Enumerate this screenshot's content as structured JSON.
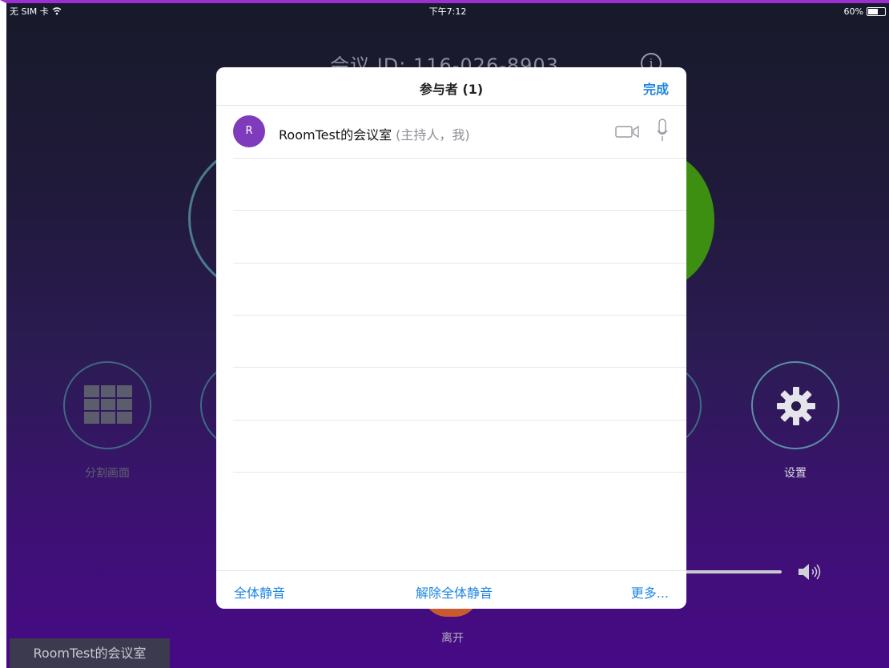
{
  "status_bar": {
    "carrier": "无 SIM 卡",
    "time": "下午7:12",
    "battery": "60%",
    "battery_level": 0.6
  },
  "meeting": {
    "id_text": "会议 ID: 116-026-8903"
  },
  "actions": {
    "split_view_label": "分割画面",
    "settings_label": "设置",
    "leave_label": "离开"
  },
  "volume_level": 1.0,
  "room_tag": "RoomTest的会议室",
  "modal": {
    "title": "参与者 (1)",
    "done_label": "完成",
    "participants": [
      {
        "avatar_initial": "R",
        "name": "RoomTest的会议室",
        "role": " (主持人，我)"
      }
    ],
    "footer": {
      "mute_all": "全体静音",
      "unmute_all": "解除全体静音",
      "more": "更多..."
    }
  },
  "colors": {
    "accent_blue": "#1e86e0",
    "avatar_purple": "#7e3bbb",
    "video_green": "#3c8f10",
    "leave_orange": "#c95a2f"
  }
}
